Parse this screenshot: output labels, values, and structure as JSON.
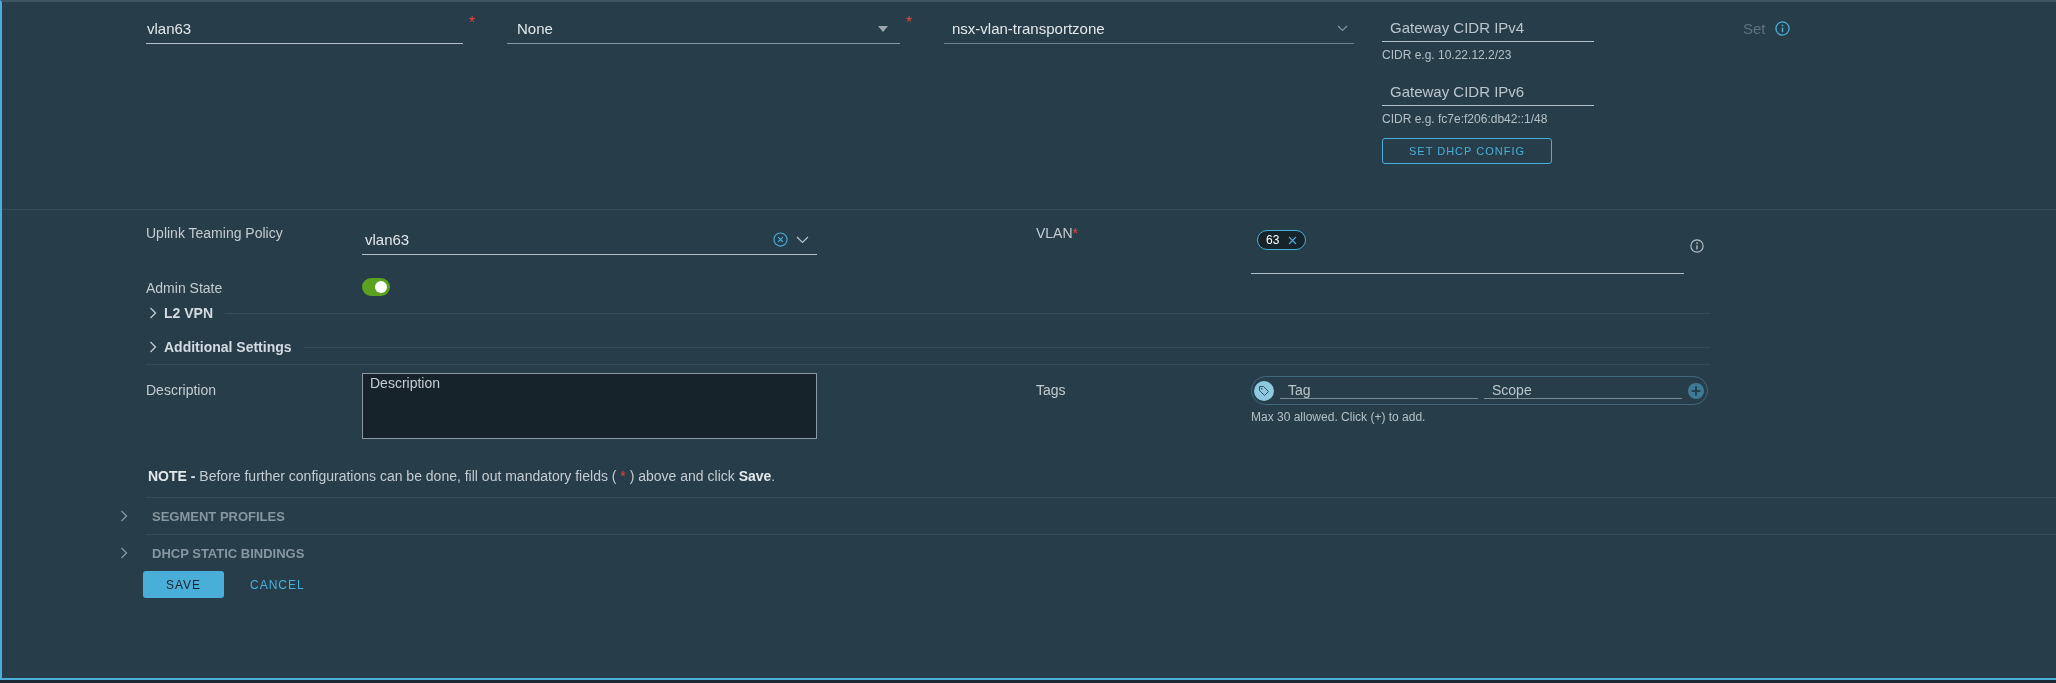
{
  "required_mark": "*",
  "top_row": {
    "segment_name": {
      "value": "vlan63",
      "required": true
    },
    "connectivity": {
      "value": "None",
      "required": true
    },
    "transport_zone": {
      "value": "nsx-vlan-transportzone"
    },
    "gateways": [
      {
        "placeholder": "Gateway CIDR IPv4",
        "hint": "CIDR e.g. 10.22.12.2/23"
      },
      {
        "placeholder": "Gateway CIDR IPv6",
        "hint": "CIDR e.g. fc7e:f206:db42::1/48"
      }
    ],
    "dhcp_button": "SET DHCP CONFIG",
    "set_link": {
      "label": "Set",
      "disabled": true
    }
  },
  "uplink_teaming_policy": {
    "label": "Uplink Teaming Policy",
    "value": "vlan63"
  },
  "vlan": {
    "label": "VLAN",
    "required": true,
    "chips": [
      "63"
    ]
  },
  "admin_state": {
    "label": "Admin State",
    "on": true
  },
  "sections": [
    {
      "label": "L2 VPN",
      "expanded": false
    },
    {
      "label": "Additional Settings",
      "expanded": false
    }
  ],
  "description": {
    "label": "Description",
    "placeholder": "Description"
  },
  "tags": {
    "label": "Tags",
    "tag_placeholder": "Tag",
    "scope_placeholder": "Scope",
    "hint": "Max 30 allowed. Click (+) to add."
  },
  "note": "**NOTE -** Before further configurations can be done, fill out mandatory fields ( ",
  "note_end": " ) above and click **Save**.",
  "panels": [
    {
      "label": "SEGMENT PROFILES",
      "expanded": false
    },
    {
      "label": "DHCP STATIC BINDINGS",
      "expanded": false
    }
  ],
  "buttons": [
    {
      "label": "SAVE",
      "kind": "primary"
    },
    {
      "label": "CANCEL",
      "kind": "link"
    }
  ]
}
